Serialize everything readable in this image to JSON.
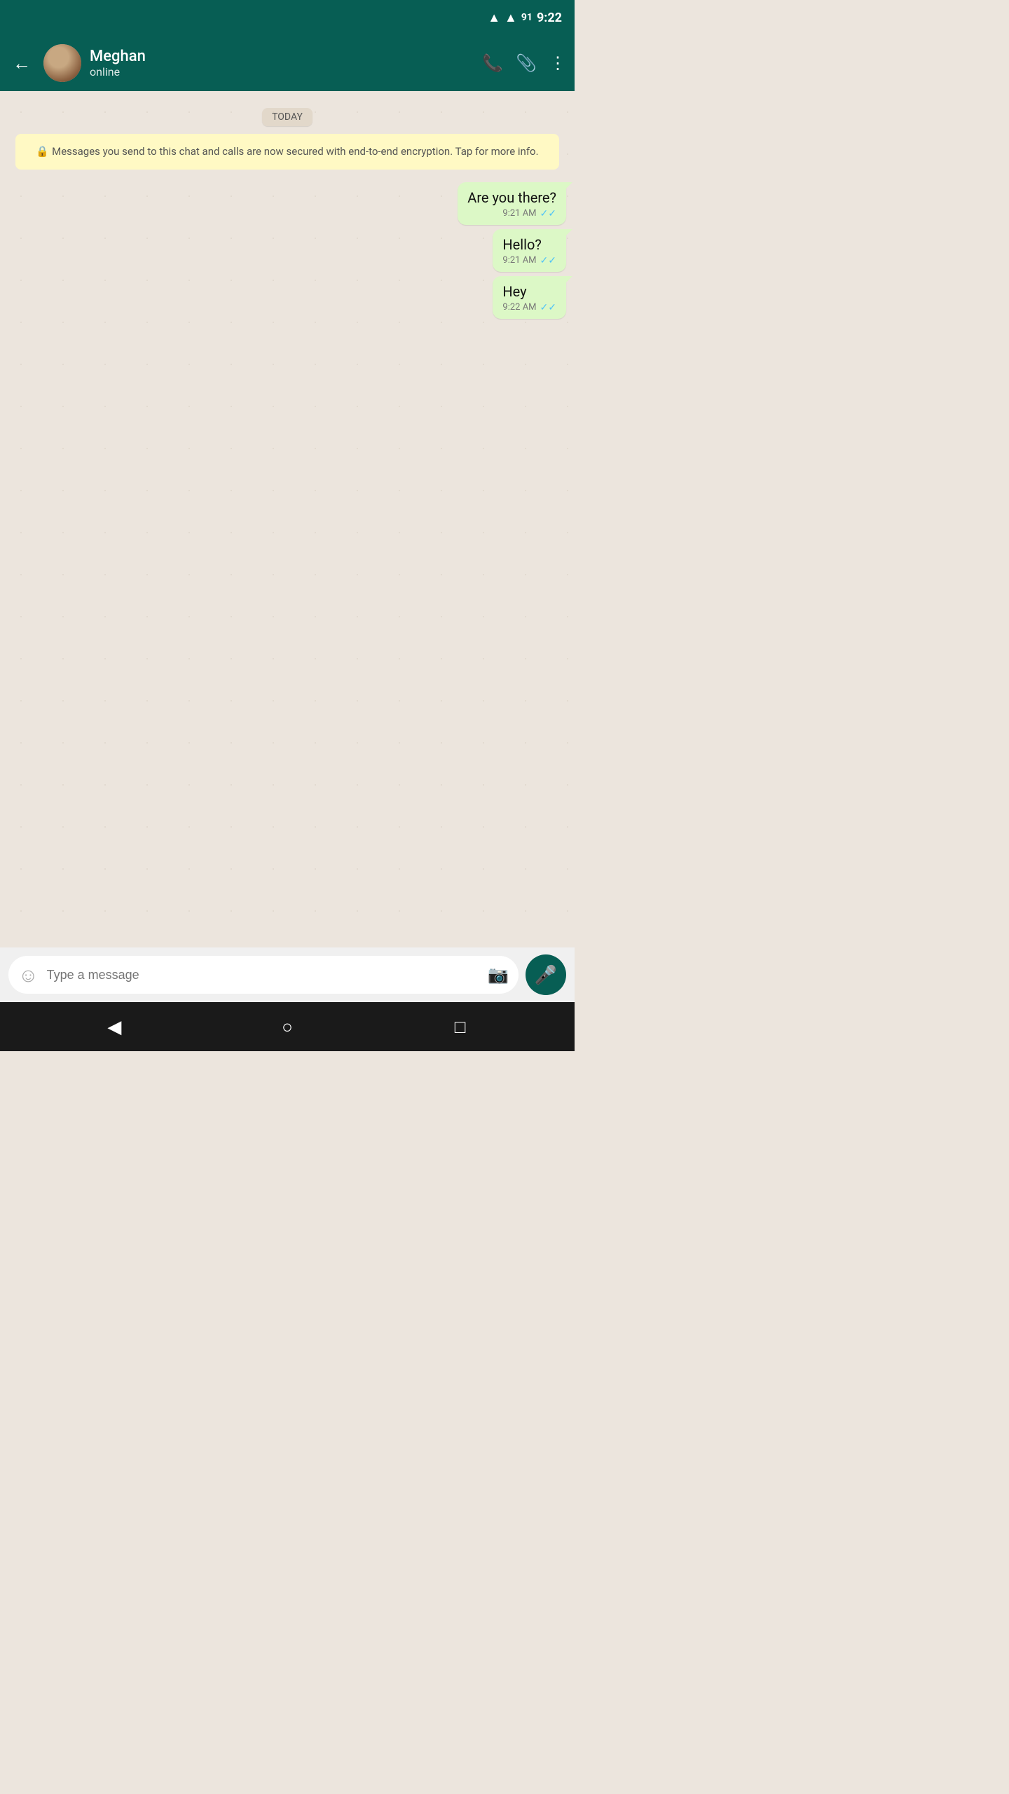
{
  "statusBar": {
    "time": "9:22",
    "batteryLevel": "91"
  },
  "header": {
    "contactName": "Meghan",
    "contactStatus": "online",
    "backLabel": "←"
  },
  "chat": {
    "dateBadge": "TODAY",
    "encryptionNotice": "Messages you send to this chat and calls are now secured with end-to-end encryption. Tap for more info.",
    "messages": [
      {
        "text": "Are you there?",
        "time": "9:21 AM",
        "ticks": "✓✓"
      },
      {
        "text": "Hello?",
        "time": "9:21 AM",
        "ticks": "✓✓"
      },
      {
        "text": "Hey",
        "time": "9:22 AM",
        "ticks": "✓✓"
      }
    ]
  },
  "inputBar": {
    "placeholder": "Type a message"
  },
  "navbar": {
    "backIcon": "◀",
    "homeIcon": "○",
    "recentIcon": "□"
  },
  "icons": {
    "phone": "📞",
    "attachment": "📎",
    "more": "⋮",
    "emoji": "☺",
    "camera": "📷",
    "mic": "🎤",
    "lock": "🔒"
  }
}
